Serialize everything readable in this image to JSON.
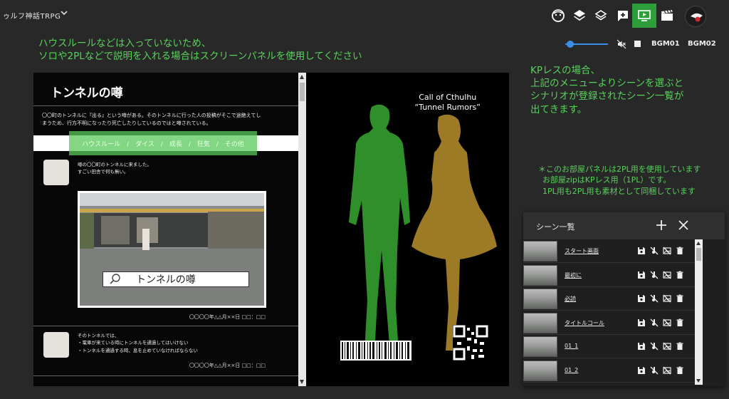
{
  "room": {
    "title": "ゥルフ神話TRPG"
  },
  "toolbar": {
    "icons": [
      "face-icon",
      "layers-icon",
      "layers-outline-icon",
      "add-comment-icon",
      "screen-panel-icon",
      "scene-clapper-icon"
    ],
    "active_icon": "screen-panel-icon",
    "accent": "#2e9e3a"
  },
  "notes": {
    "top_line1": "ハウスルールなどは入っていないため、",
    "top_line2": "ソロや2PLなどで説明を入れる場合はスクリーンパネルを使用してください",
    "right_line1": "KPレスの場合、",
    "right_line2": "上記のメニューよりシーンを選ぶと",
    "right_line3": "シナリオが登録されたシーン一覧が",
    "right_line4": "出てきます。",
    "small_line1": "＊このお部屋パネルは2PL用を使用しています",
    "small_line2": "お部屋zipはKPレス用（1PL）です。",
    "small_line3": "1PL用も2PL用も素材として同梱しています",
    "color": "#57d35a"
  },
  "bgm": {
    "volume": 0.1,
    "track1": "BGM01",
    "track2": "BGM02"
  },
  "left_panel": {
    "title": "トンネルの噂",
    "intro_line1": "〇〇町のトンネルに『出る』という噂がある。そのトンネルに行った人の投稿がそこで途絶えてし",
    "intro_line2": "まうため、行方不明になったり死亡したりしているのではと噂されている。",
    "menu": "ハウスルール　/　ダイス　/　成長　/　狂気　/　その他",
    "post1_line1": "噂の〇〇町のトンネルに来ました。",
    "post1_line2": "すごい田舎で何も無い。",
    "search_text": "トンネルの噂",
    "post1_date": "〇〇〇〇年△△月××日 □□：□□",
    "post2_line1": "そのトンネルでは、",
    "post2_line2": "・電車が来ている時にトンネルを通過してはいけない",
    "post2_line3": "・トンネルを通過する時、息を止めていなければならない",
    "post2_date": "〇〇〇〇年△△月××日 □□：□□"
  },
  "right_panel": {
    "title_line1": "Call of Cthulhu",
    "title_line2": "“Tunnel Rumors”",
    "figure1_color": "#2f8f2a",
    "figure2_color": "#9c7a26"
  },
  "scene_list": {
    "title": "シーン一覧",
    "scenes": [
      {
        "name": "スタート画面"
      },
      {
        "name": "最初に"
      },
      {
        "name": "必読"
      },
      {
        "name": "タイトルコール"
      },
      {
        "name": "01_1"
      },
      {
        "name": "01_2"
      }
    ]
  }
}
